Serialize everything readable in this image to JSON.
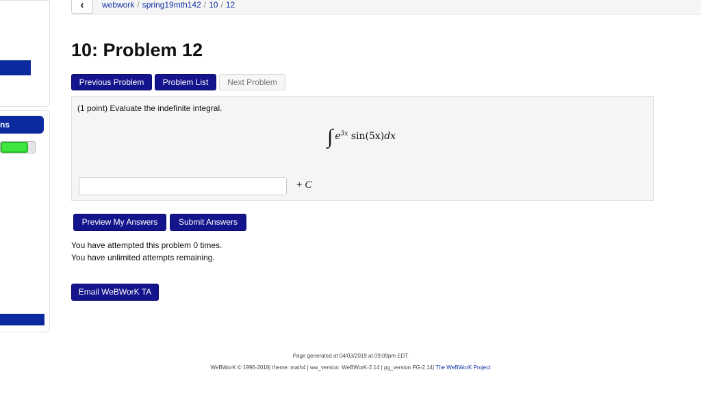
{
  "breadcrumb": {
    "back_icon": "chevron-left-icon",
    "back_glyph": "‹",
    "items": [
      "webwork",
      "spring19mth142",
      "10",
      "12"
    ],
    "separator": "/"
  },
  "page": {
    "title": "10: Problem 12"
  },
  "nav": {
    "previous": "Previous Problem",
    "list": "Problem List",
    "next": "Next Problem"
  },
  "sidebar": {
    "tab_label": "ns",
    "progress": 0.8
  },
  "problem": {
    "statement": "(1 point) Evaluate the indefinite integral.",
    "integral_sign": "∫",
    "integrand_base": "e",
    "integrand_exponent": "3x",
    "integrand_rest": "sin(5x)",
    "differential": "dx",
    "answer_value": "",
    "constant_plus": "+",
    "constant_symbol": "C"
  },
  "actions": {
    "preview": "Preview My Answers",
    "submit": "Submit Answers",
    "email": "Email WeBWorK TA"
  },
  "attempts": {
    "line1": "You have attempted this problem 0 times.",
    "line2": "You have unlimited attempts remaining."
  },
  "footer": {
    "generated": "Page generated at 04/03/2019 at 09:09pm EDT",
    "info": "WeBWorK © 1996-2018| theme: math4 | ww_version: WeBWorK-2.14 | pg_version PG-2.14|",
    "project_link": "The WeBWorK Project"
  },
  "colors": {
    "primary": "#14148c",
    "progress_fill": "#3ee53e",
    "link": "#0f2fa4"
  }
}
